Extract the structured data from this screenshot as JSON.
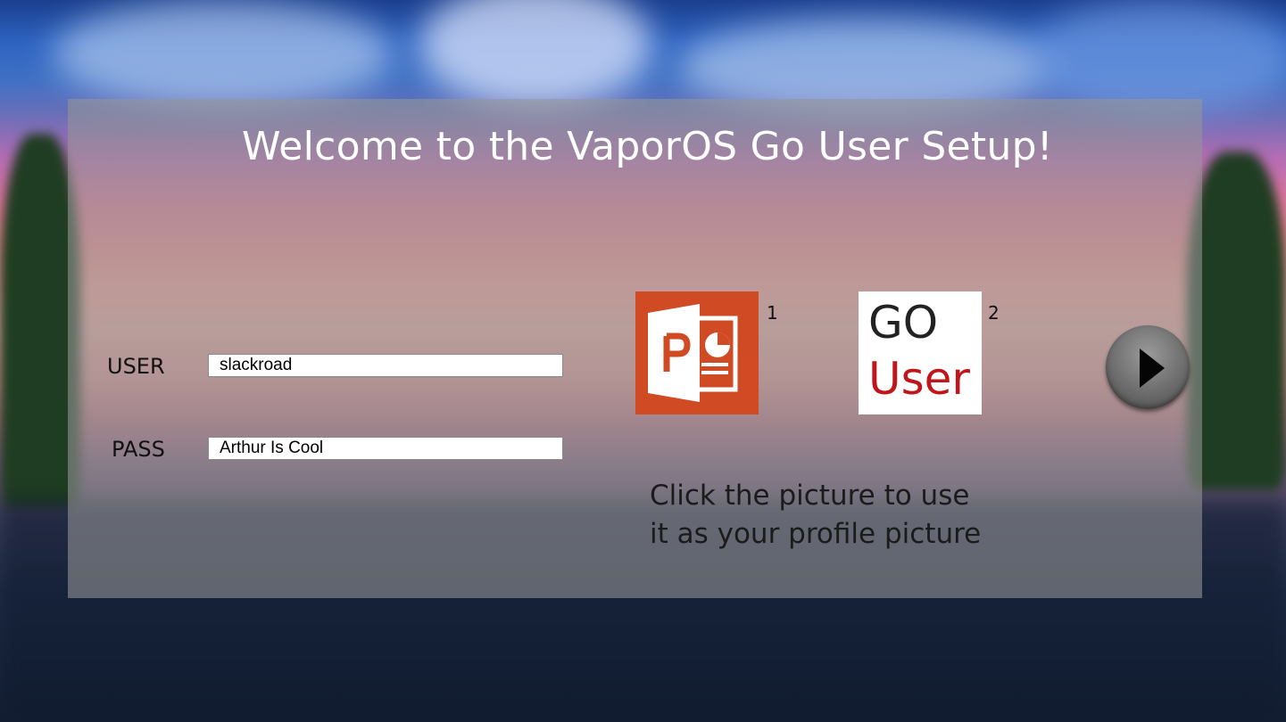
{
  "setup": {
    "title": "Welcome to the VaporOS Go User Setup!",
    "user_label": "USER",
    "user_value": "slackroad",
    "pass_label": "PASS",
    "pass_value": "Arthur Is Cool",
    "hint_line1": "Click the picture to use",
    "hint_line2": "it as your profile picture"
  },
  "pictures": [
    {
      "number": "1",
      "icon": "powerpoint-icon",
      "color": "#d04a24"
    },
    {
      "number": "2",
      "line1": "GO",
      "line2": "User",
      "line2_color": "#c0151b"
    }
  ],
  "next_button": {
    "icon": "play-arrow-icon"
  }
}
